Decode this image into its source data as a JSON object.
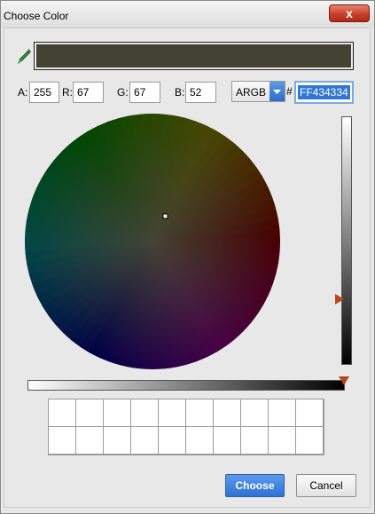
{
  "window": {
    "title": "Choose Color",
    "close_glyph": "x"
  },
  "icons": {
    "eyedropper": "eyedropper-icon",
    "dropdown": "chevron-down-icon"
  },
  "color": {
    "current_hex": "#434334"
  },
  "fields": {
    "a_label": "A:",
    "a_value": "255",
    "r_label": "R:",
    "r_value": "67",
    "g_label": "G:",
    "g_value": "67",
    "b_label": "B:",
    "b_value": "52"
  },
  "mode": {
    "selected": "ARGB"
  },
  "hex": {
    "prefix": "#",
    "value": "FF434334"
  },
  "sliders": {
    "brightness_fraction": 0.26,
    "alpha_fraction": 1.0
  },
  "buttons": {
    "choose": "Choose",
    "cancel": "Cancel"
  },
  "palette": {
    "rows": 2,
    "columns": 10
  },
  "colors": {
    "accent": "#2f72d4",
    "slider_thumb": "#b8471e",
    "close_button": "#c6402a"
  }
}
